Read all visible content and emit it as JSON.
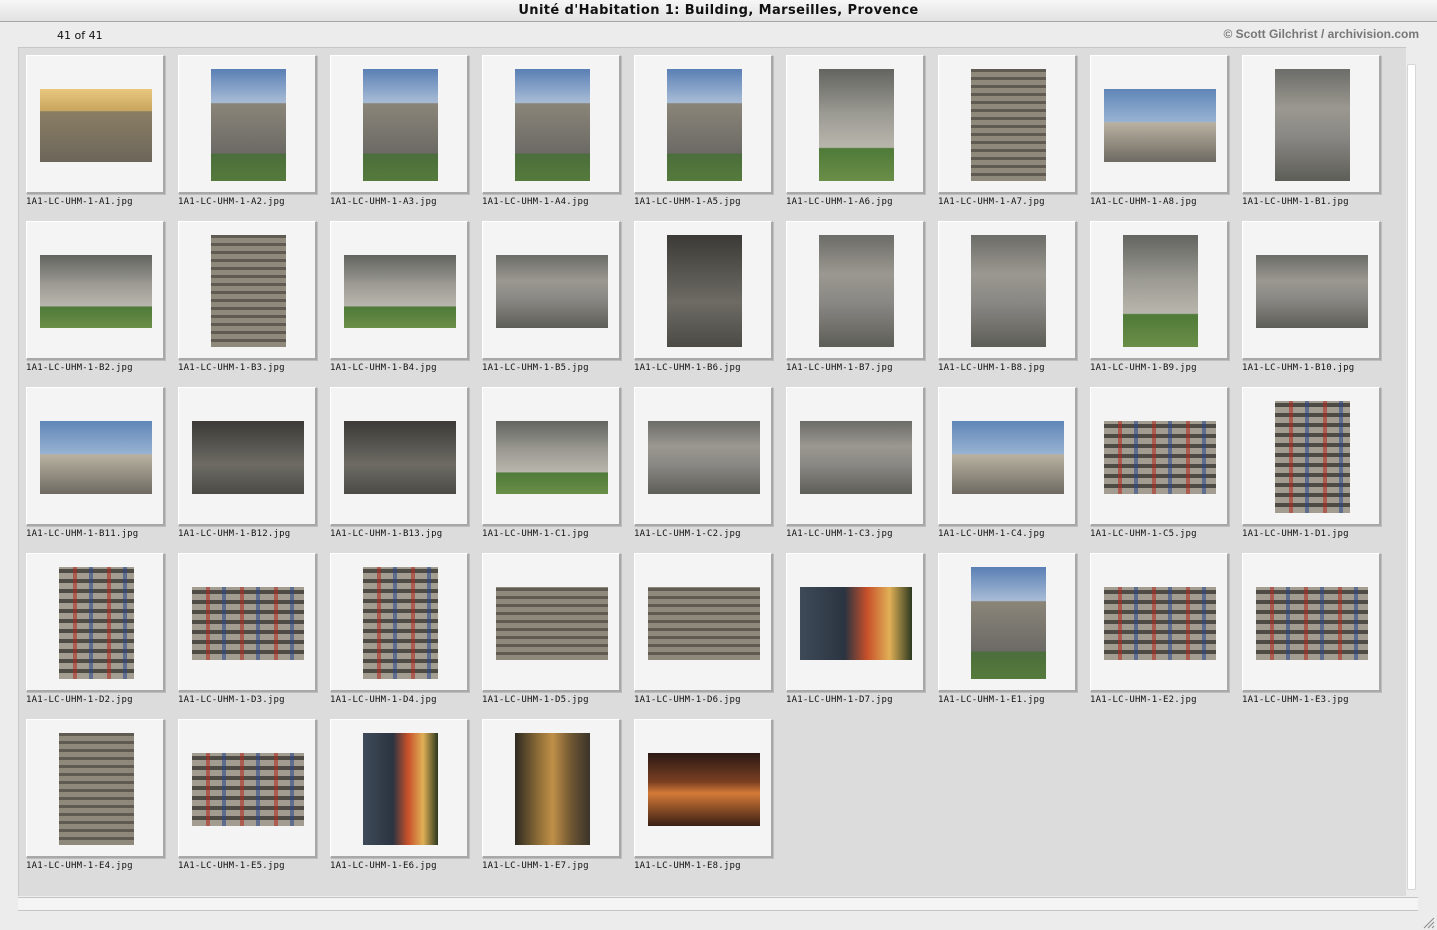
{
  "window": {
    "title": "Unité d'Habitation 1: Building, Marseilles, Provence"
  },
  "header": {
    "count_label": "41 of 41",
    "copyright": "© Scott Gilchrist / archivision.com"
  },
  "thumbnails": [
    {
      "filename": "1A1-LC-UHM-1-A1.jpg",
      "style": "ph-sunset",
      "orientation": "landscape"
    },
    {
      "filename": "1A1-LC-UHM-1-A2.jpg",
      "style": "ph-sky-bldg",
      "orientation": "portrait"
    },
    {
      "filename": "1A1-LC-UHM-1-A3.jpg",
      "style": "ph-sky-bldg",
      "orientation": "portrait"
    },
    {
      "filename": "1A1-LC-UHM-1-A4.jpg",
      "style": "ph-sky-bldg",
      "orientation": "portrait"
    },
    {
      "filename": "1A1-LC-UHM-1-A5.jpg",
      "style": "ph-sky-bldg",
      "orientation": "portrait"
    },
    {
      "filename": "1A1-LC-UHM-1-A6.jpg",
      "style": "ph-pilotis-green",
      "orientation": "portrait"
    },
    {
      "filename": "1A1-LC-UHM-1-A7.jpg",
      "style": "ph-facade",
      "orientation": "portrait"
    },
    {
      "filename": "1A1-LC-UHM-1-A8.jpg",
      "style": "ph-sky",
      "orientation": "landscape"
    },
    {
      "filename": "1A1-LC-UHM-1-B1.jpg",
      "style": "ph-pilotis",
      "orientation": "portrait"
    },
    {
      "filename": "1A1-LC-UHM-1-B2.jpg",
      "style": "ph-pilotis-green",
      "orientation": "landscape"
    },
    {
      "filename": "1A1-LC-UHM-1-B3.jpg",
      "style": "ph-facade",
      "orientation": "portrait"
    },
    {
      "filename": "1A1-LC-UHM-1-B4.jpg",
      "style": "ph-pilotis-green",
      "orientation": "landscape"
    },
    {
      "filename": "1A1-LC-UHM-1-B5.jpg",
      "style": "ph-pilotis",
      "orientation": "landscape"
    },
    {
      "filename": "1A1-LC-UHM-1-B6.jpg",
      "style": "ph-dark",
      "orientation": "portrait"
    },
    {
      "filename": "1A1-LC-UHM-1-B7.jpg",
      "style": "ph-pilotis",
      "orientation": "portrait"
    },
    {
      "filename": "1A1-LC-UHM-1-B8.jpg",
      "style": "ph-pilotis",
      "orientation": "portrait"
    },
    {
      "filename": "1A1-LC-UHM-1-B9.jpg",
      "style": "ph-pilotis-green",
      "orientation": "portrait"
    },
    {
      "filename": "1A1-LC-UHM-1-B10.jpg",
      "style": "ph-pilotis",
      "orientation": "landscape"
    },
    {
      "filename": "1A1-LC-UHM-1-B11.jpg",
      "style": "ph-sky",
      "orientation": "landscape"
    },
    {
      "filename": "1A1-LC-UHM-1-B12.jpg",
      "style": "ph-dark",
      "orientation": "landscape"
    },
    {
      "filename": "1A1-LC-UHM-1-B13.jpg",
      "style": "ph-dark",
      "orientation": "landscape"
    },
    {
      "filename": "1A1-LC-UHM-1-C1.jpg",
      "style": "ph-pilotis-green",
      "orientation": "landscape"
    },
    {
      "filename": "1A1-LC-UHM-1-C2.jpg",
      "style": "ph-pilotis",
      "orientation": "landscape"
    },
    {
      "filename": "1A1-LC-UHM-1-C3.jpg",
      "style": "ph-pilotis",
      "orientation": "landscape"
    },
    {
      "filename": "1A1-LC-UHM-1-C4.jpg",
      "style": "ph-sky",
      "orientation": "landscape"
    },
    {
      "filename": "1A1-LC-UHM-1-C5.jpg",
      "style": "ph-facade-color",
      "orientation": "landscape"
    },
    {
      "filename": "1A1-LC-UHM-1-D1.jpg",
      "style": "ph-facade-color",
      "orientation": "portrait"
    },
    {
      "filename": "1A1-LC-UHM-1-D2.jpg",
      "style": "ph-facade-color",
      "orientation": "portrait"
    },
    {
      "filename": "1A1-LC-UHM-1-D3.jpg",
      "style": "ph-facade-color",
      "orientation": "landscape"
    },
    {
      "filename": "1A1-LC-UHM-1-D4.jpg",
      "style": "ph-facade-color",
      "orientation": "portrait"
    },
    {
      "filename": "1A1-LC-UHM-1-D5.jpg",
      "style": "ph-facade",
      "orientation": "landscape"
    },
    {
      "filename": "1A1-LC-UHM-1-D6.jpg",
      "style": "ph-facade",
      "orientation": "landscape"
    },
    {
      "filename": "1A1-LC-UHM-1-D7.jpg",
      "style": "ph-window",
      "orientation": "landscape"
    },
    {
      "filename": "1A1-LC-UHM-1-E1.jpg",
      "style": "ph-sky-bldg",
      "orientation": "portrait"
    },
    {
      "filename": "1A1-LC-UHM-1-E2.jpg",
      "style": "ph-facade-color",
      "orientation": "landscape"
    },
    {
      "filename": "1A1-LC-UHM-1-E3.jpg",
      "style": "ph-facade-color",
      "orientation": "landscape"
    },
    {
      "filename": "1A1-LC-UHM-1-E4.jpg",
      "style": "ph-facade",
      "orientation": "portrait"
    },
    {
      "filename": "1A1-LC-UHM-1-E5.jpg",
      "style": "ph-facade-color",
      "orientation": "landscape"
    },
    {
      "filename": "1A1-LC-UHM-1-E6.jpg",
      "style": "ph-window",
      "orientation": "portrait"
    },
    {
      "filename": "1A1-LC-UHM-1-E7.jpg",
      "style": "ph-gold",
      "orientation": "portrait"
    },
    {
      "filename": "1A1-LC-UHM-1-E8.jpg",
      "style": "ph-interior",
      "orientation": "landscape"
    }
  ],
  "scrollbar": {
    "vertical_icon": "scrollbar-vertical",
    "grow_icon": "resize-grip-icon"
  }
}
